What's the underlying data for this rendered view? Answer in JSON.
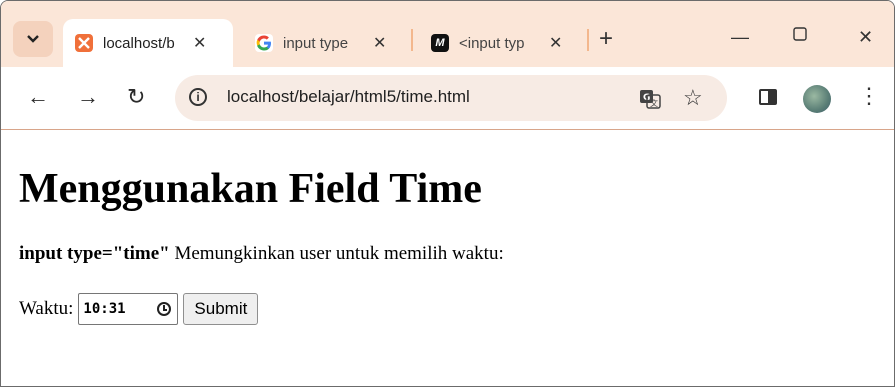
{
  "browser": {
    "tabs": [
      {
        "label": "localhost/b",
        "favicon": "xampp-icon",
        "favicon_color": "#f0703a",
        "active": true
      },
      {
        "label": "input type",
        "favicon": "google-icon",
        "active": false
      },
      {
        "label": "<input typ",
        "favicon": "m-icon",
        "active": false
      }
    ],
    "new_tab": "+",
    "url": "localhost/belajar/html5/time.html"
  },
  "page": {
    "heading": "Menggunakan Field Time",
    "desc_bold": "input type=\"time\"",
    "desc_text": " Memungkinkan user untuk memilih waktu:",
    "form": {
      "label": "Waktu:",
      "time_value": "10:31",
      "submit_label": "Submit"
    }
  }
}
